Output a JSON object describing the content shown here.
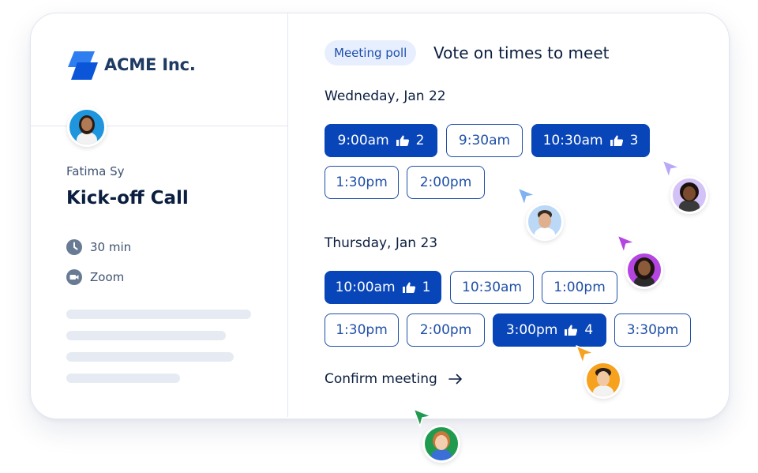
{
  "brand": {
    "name": "ACME Inc."
  },
  "host": {
    "name": "Fatima Sy"
  },
  "event": {
    "title": "Kick-off Call",
    "duration": "30 min",
    "location": "Zoom"
  },
  "poll": {
    "badge": "Meeting poll",
    "title": "Vote on times to meet",
    "days": [
      {
        "label": "Wedneday, Jan 22",
        "slots": [
          {
            "time": "9:00am",
            "votes": "2",
            "selected": true
          },
          {
            "time": "9:30am",
            "selected": false
          },
          {
            "time": "10:30am",
            "votes": "3",
            "selected": true
          },
          {
            "time": "1:30pm",
            "selected": false
          },
          {
            "time": "2:00pm",
            "selected": false
          }
        ]
      },
      {
        "label": "Thursday, Jan 23",
        "slots": [
          {
            "time": "10:00am",
            "votes": "1",
            "selected": true
          },
          {
            "time": "10:30am",
            "selected": false
          },
          {
            "time": "1:00pm",
            "selected": false
          },
          {
            "time": "1:30pm",
            "selected": false
          },
          {
            "time": "2:00pm",
            "selected": false
          },
          {
            "time": "3:00pm",
            "votes": "4",
            "selected": true
          },
          {
            "time": "3:30pm",
            "selected": false
          }
        ]
      }
    ],
    "confirm_label": "Confirm meeting"
  },
  "colors": {
    "primary": "#0845b8",
    "accent_light": "#e7efff",
    "cursor_blue": "#7fb2f0",
    "cursor_lavender": "#b9a8f5",
    "cursor_purple": "#b545e0",
    "cursor_orange": "#f6a21e",
    "cursor_green": "#1f9a4f"
  },
  "icons": {
    "logo": "acme-logo-icon",
    "duration": "clock-icon",
    "location": "video-camera-icon",
    "vote": "thumbs-up-icon",
    "confirm": "arrow-right-icon"
  }
}
